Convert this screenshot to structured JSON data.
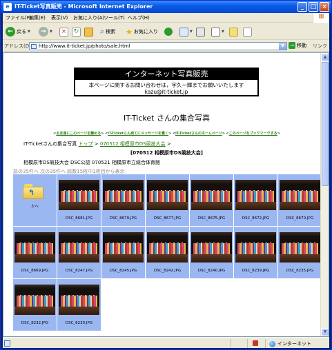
{
  "window": {
    "title": "IT-Ticket写真販売 - Microsoft Internet Explorer"
  },
  "menu": [
    "ファイル(F)",
    "編集(E)",
    "表示(V)",
    "お気に入り(A)",
    "ツール(T)",
    "ヘルプ(H)"
  ],
  "toolbar": {
    "back": "戻る",
    "search": "検索",
    "favorites": "お気に入り"
  },
  "address": {
    "label": "アドレス(D)",
    "url": "http://www.it-ticket.jp/photo/sale.html",
    "go": "移動",
    "links": "リンク"
  },
  "page": {
    "banner_title": "インターネット写真販売",
    "banner_line1": "本ページに関するお問い合わせは，宇久一輝までお願いいたします",
    "banner_line2": "kazu@it-ticket.jp",
    "album_title": "IT-Ticket さんの集合写真",
    "links": [
      {
        "open": "<",
        "text": "お友達にこのページを薦める",
        "close": ">"
      },
      {
        "open": "<",
        "text": "IT-Ticketさん宛てにメッセージを書く",
        "close": ">"
      },
      {
        "open": "<",
        "text": "IT-Ticketさんのホームページ",
        "close": ">"
      },
      {
        "open": "<",
        "text": "このページをブックマークする",
        "close": ">"
      }
    ],
    "breadcrumb_prefix": "IT-Ticketさんの集合写真",
    "breadcrumb_top": "トップ",
    "breadcrumb_sep1": " > ",
    "breadcrumb_album": "070512 相模原市DS競技大会",
    "breadcrumb_sep2": " >",
    "subtitle": "[070512 相模原市DS競技大会]",
    "description": "相模原市DS競技大会 DSC公認 070521 相模原市立総合体育館",
    "paging": "前の35件へ 次の35件へ 総数15枚中1枚目から表示",
    "up_label": "上へ",
    "photos": [
      "DSC_8681.JPG",
      "DSC_8679.JPG",
      "DSC_8677.JPG",
      "DSC_8675.JPG",
      "DSC_8672.JPG",
      "DSC_8670.JPG",
      "DSC_8669.JPG",
      "DSC_8247.JPG",
      "DSC_8245.JPG",
      "DSC_8242.JPG",
      "DSC_8240.JPG",
      "DSC_8239.JPG",
      "DSC_8235.JPG",
      "DSC_8232.JPG",
      "DSC_8230.JPG"
    ]
  },
  "status": {
    "zone": "インターネット"
  }
}
